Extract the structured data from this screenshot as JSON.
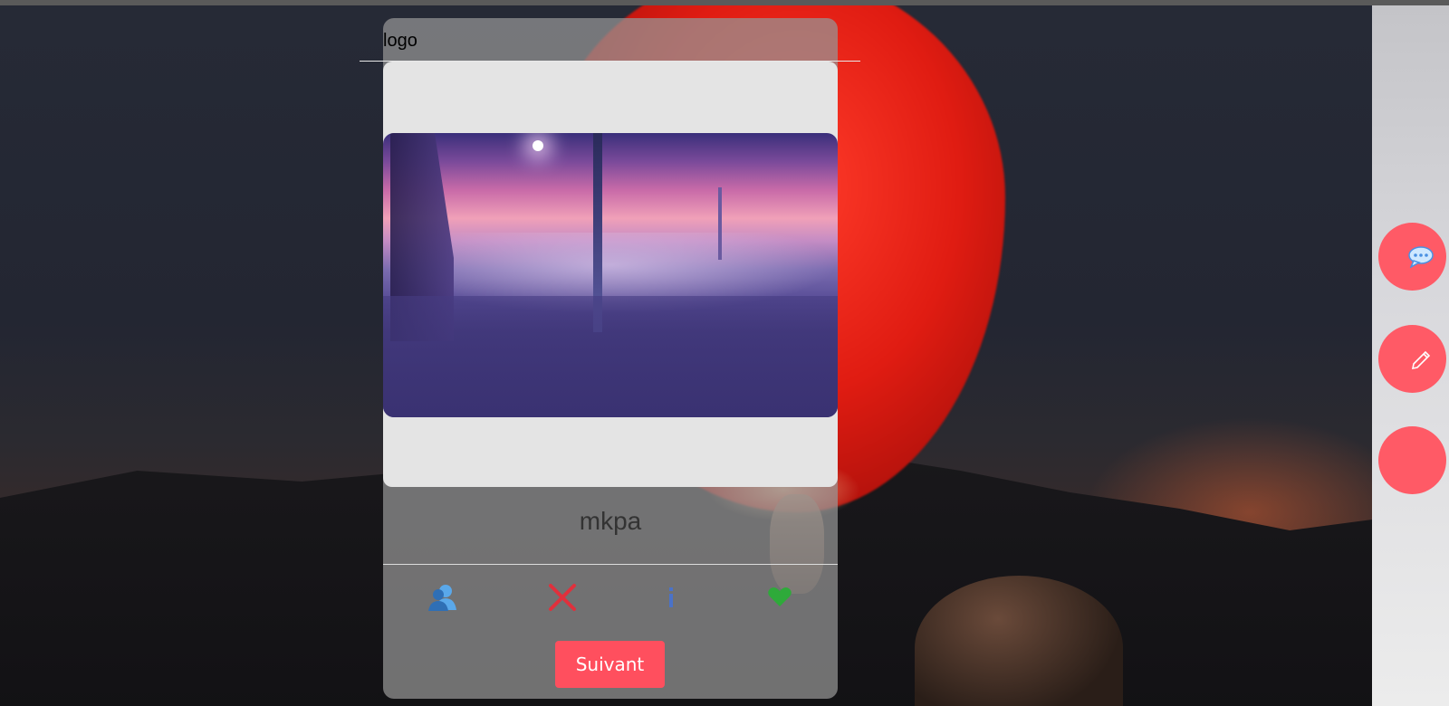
{
  "header": {
    "logo_text": "logo"
  },
  "profile": {
    "name": "mkpa",
    "photo_icon": "futuristic-city-photo"
  },
  "actions": [
    {
      "name": "friends-icon",
      "color": "#4a90e2"
    },
    {
      "name": "close-icon",
      "color": "#e0303c"
    },
    {
      "name": "info-icon",
      "color": "#4a72c8"
    },
    {
      "name": "heart-icon",
      "color": "#2eaa3a"
    }
  ],
  "next_button": {
    "label": "Suivant",
    "color": "#ff4f5e"
  },
  "side_buttons": [
    {
      "name": "chat-icon",
      "color": "#ff5a66"
    },
    {
      "name": "pencil-icon",
      "color": "#ff5a66"
    },
    {
      "name": "blank",
      "color": "#ff5a66"
    }
  ]
}
